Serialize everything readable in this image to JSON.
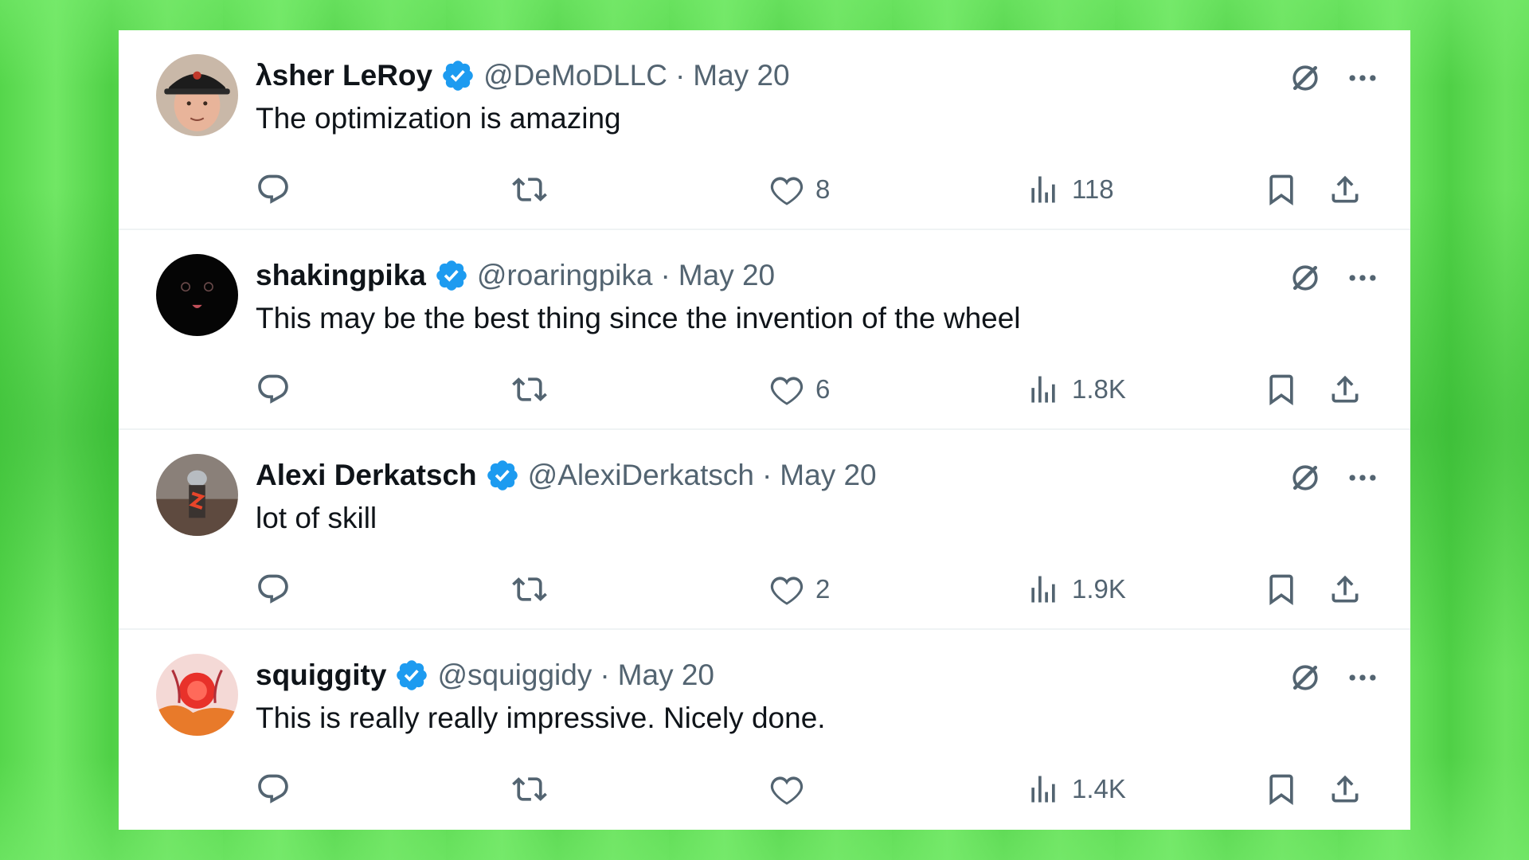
{
  "tweets": [
    {
      "display_name": "λsher LeRoy",
      "handle": "@DeMoDLLC",
      "separator": "·",
      "date": "May 20",
      "text": "The optimization is amazing",
      "likes": "8",
      "views": "118",
      "replies": "",
      "retweets": "",
      "avatar_icon": "person-cap-avatar"
    },
    {
      "display_name": "shakingpika",
      "handle": "@roaringpika",
      "separator": "·",
      "date": "May 20",
      "text": "This may be the best thing since the invention of the wheel",
      "likes": "6",
      "views": "1.8K",
      "replies": "",
      "retweets": "",
      "avatar_icon": "dark-creature-avatar"
    },
    {
      "display_name": "Alexi Derkatsch",
      "handle": "@AlexiDerkatsch",
      "separator": "·",
      "date": "May 20",
      "text": "lot of skill",
      "likes": "2",
      "views": "1.9K",
      "replies": "",
      "retweets": "",
      "avatar_icon": "photo-avatar"
    },
    {
      "display_name": "squiggity",
      "handle": "@squiggidy",
      "separator": "·",
      "date": "May 20",
      "text": "This is really really impressive. Nicely done.",
      "likes": "",
      "views": "1.4K",
      "replies": "",
      "retweets": "",
      "avatar_icon": "illustrated-avatar"
    }
  ],
  "icons": {
    "verified": "verified-badge-icon",
    "grok": "grok-icon",
    "more": "more-options-icon",
    "reply": "reply-icon",
    "retweet": "retweet-icon",
    "like": "like-heart-icon",
    "views": "views-chart-icon",
    "bookmark": "bookmark-icon",
    "share": "share-icon"
  },
  "colors": {
    "verified_blue": "#1d9bf0",
    "icon_gray": "#536471",
    "text": "#0f1419",
    "background_green": "#5fdc55"
  }
}
